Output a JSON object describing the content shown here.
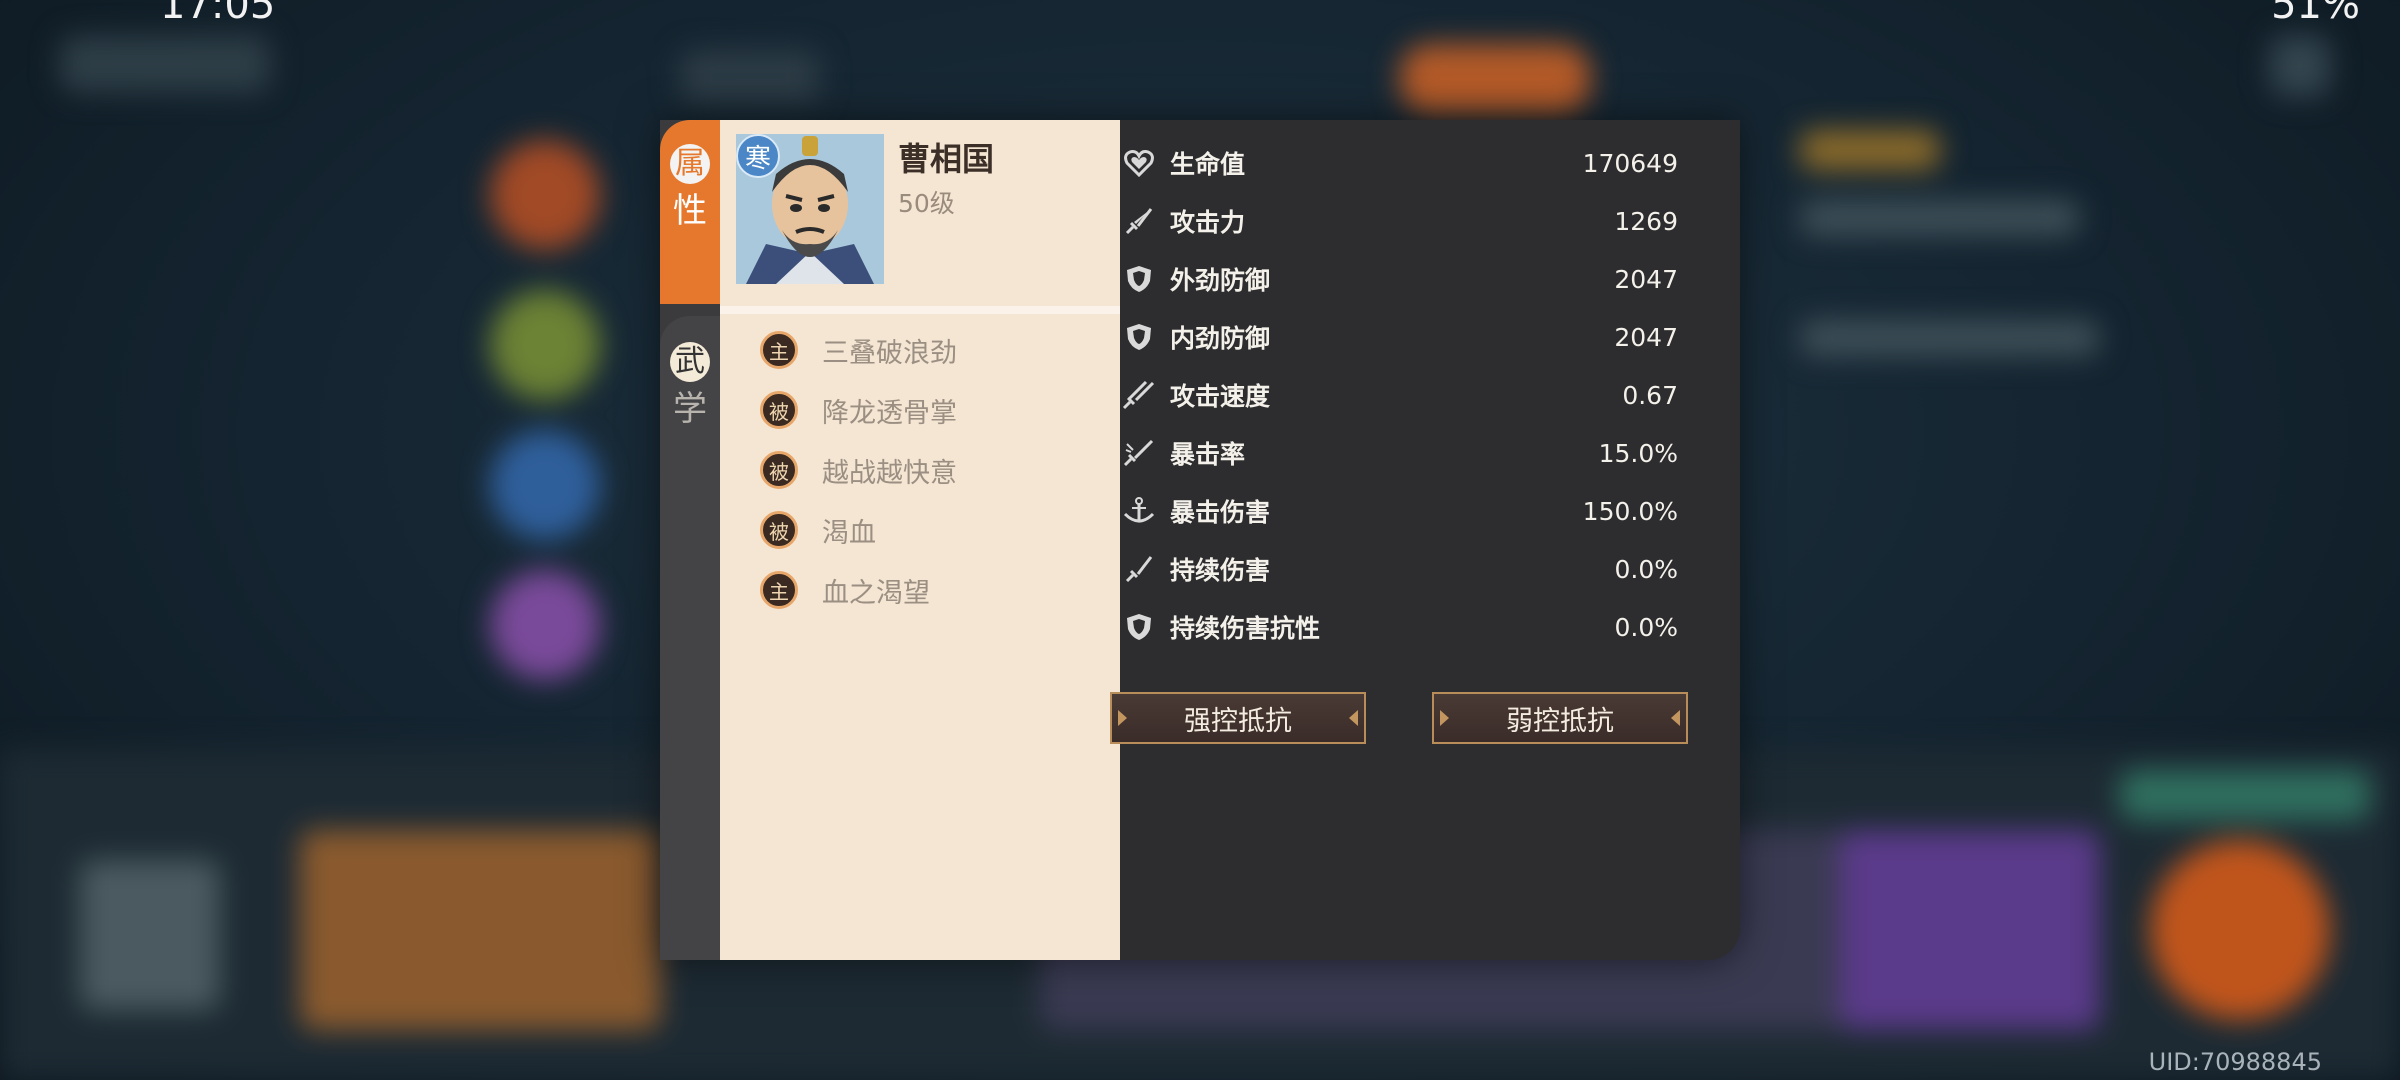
{
  "status": {
    "time": "17:05",
    "battery": "51%"
  },
  "uid": "UID:70988845",
  "tabs": [
    {
      "top": "属",
      "bottom": "性"
    },
    {
      "top": "武",
      "bottom": "学"
    }
  ],
  "hero": {
    "name": "曹相国",
    "level": "50级",
    "element": "寒"
  },
  "skills": [
    {
      "type": "主",
      "name": "三叠破浪劲"
    },
    {
      "type": "被",
      "name": "降龙透骨掌"
    },
    {
      "type": "被",
      "name": "越战越快意"
    },
    {
      "type": "被",
      "name": "渴血"
    },
    {
      "type": "主",
      "name": "血之渴望"
    }
  ],
  "stats": [
    {
      "icon": "heart-icon",
      "label": "生命值",
      "value": "170649"
    },
    {
      "icon": "sword-icon",
      "label": "攻击力",
      "value": "1269"
    },
    {
      "icon": "shield-icon",
      "label": "外劲防御",
      "value": "2047"
    },
    {
      "icon": "shield-icon",
      "label": "内劲防御",
      "value": "2047"
    },
    {
      "icon": "double-sword-icon",
      "label": "攻击速度",
      "value": "0.67"
    },
    {
      "icon": "crit-icon",
      "label": "暴击率",
      "value": "15.0%"
    },
    {
      "icon": "anchor-icon",
      "label": "暴击伤害",
      "value": "150.0%"
    },
    {
      "icon": "sword-icon",
      "label": "持续伤害",
      "value": "0.0%"
    },
    {
      "icon": "shield-icon",
      "label": "持续伤害抗性",
      "value": "0.0%"
    }
  ],
  "buttons": {
    "strong": "强控抵抗",
    "weak": "弱控抵抗"
  },
  "colors": {
    "accent": "#e5782d",
    "panel": "#2d2d2f",
    "parchment": "#f5e6d3"
  }
}
